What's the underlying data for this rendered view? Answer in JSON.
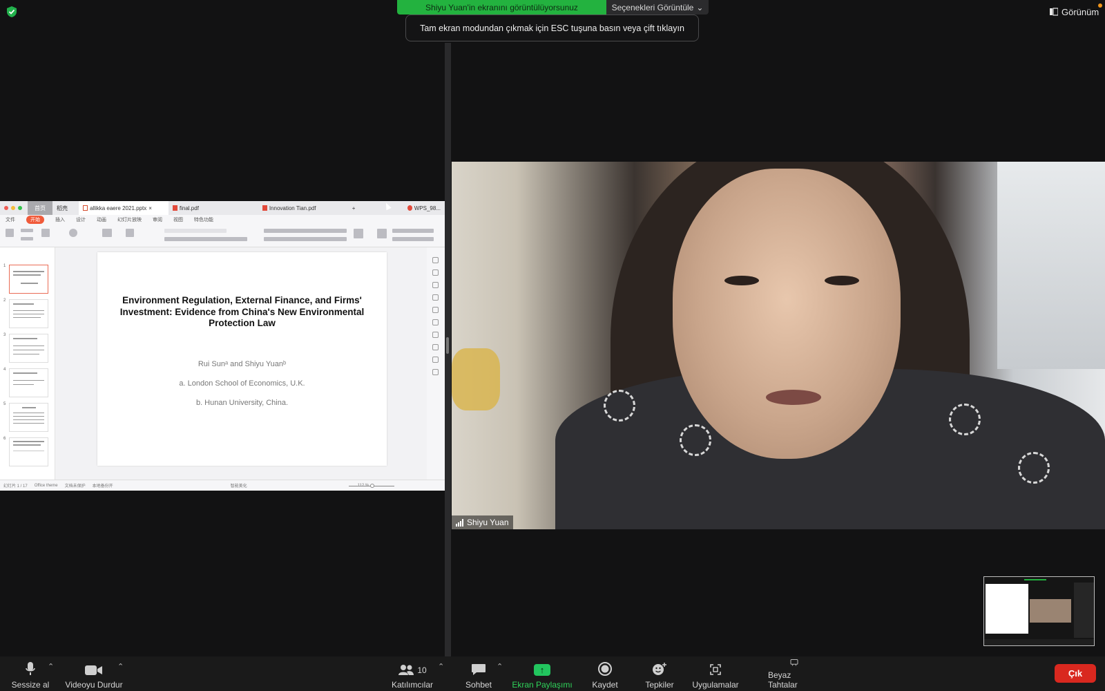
{
  "topbar": {
    "share_status": "Shiyu Yuan'in ekranını görüntülüyorsunuz",
    "view_options": "Seçenekleri Görüntüle",
    "esc_toast": "Tam ekran modundan çıkmak için ESC tuşuna basın veya çift tıklayın",
    "view_label": "Görünüm"
  },
  "shared_screen": {
    "tabs": [
      {
        "label": "首页"
      },
      {
        "label": "稻壳"
      },
      {
        "label": "allikka eaere 2021.pptx"
      },
      {
        "label": "final.pdf"
      },
      {
        "label": "Innovation Tian.pdf"
      }
    ],
    "account": "WPS_98...",
    "menu": [
      "文件",
      "开始",
      "插入",
      "设计",
      "动画",
      "幻灯片放映",
      "审阅",
      "视图",
      "特色功能"
    ],
    "slide_numbers": [
      "1",
      "2",
      "3",
      "4",
      "5",
      "6"
    ],
    "slide": {
      "title": "Environment Regulation, External Finance, and Firms' Investment: Evidence from China's New Environmental Protection Law",
      "authors": "Rui Sunᵃ and Shiyu Yuanᵇ",
      "affiliation_a": "a. London School of Economics, U.K.",
      "affiliation_b": "b. Hunan University, China."
    },
    "status": {
      "slide_count": "幻灯片 1 / 17",
      "theme": "Office theme",
      "protect": "文档未保护",
      "backup": "本地备份开",
      "smart": "智能美化",
      "zoom": "112 %"
    }
  },
  "video": {
    "participant_name": "Shiyu Yuan"
  },
  "toolbar": {
    "mute": "Sessize al",
    "video": "Videoyu Durdur",
    "participants": "Katılımcılar",
    "participant_count": "10",
    "chat": "Sohbet",
    "share": "Ekran Paylaşımı",
    "record": "Kaydet",
    "reactions": "Tepkiler",
    "apps": "Uygulamalar",
    "whiteboards": "Beyaz Tahtalar",
    "leave": "Çık"
  },
  "colors": {
    "share_green": "#23b23f",
    "leave_red": "#d9281f",
    "wps_accent": "#f05a3a"
  }
}
